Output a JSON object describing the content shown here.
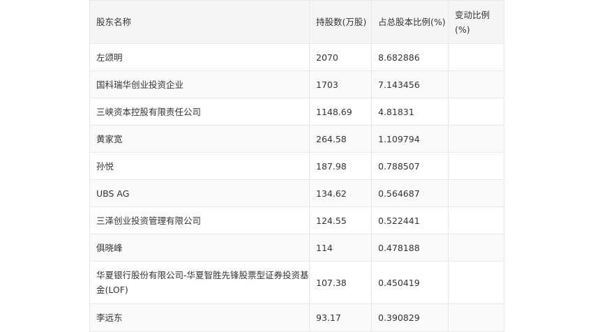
{
  "table": {
    "headers": [
      "股东名称",
      "持股数(万股)",
      "占总股本比例(%)",
      "变动比例(%)"
    ],
    "rows": [
      {
        "name": "左颂明",
        "shares": "2070",
        "ratio": "8.682886",
        "change": ""
      },
      {
        "name": "国科瑞华创业投资企业",
        "shares": "1703",
        "ratio": "7.143456",
        "change": ""
      },
      {
        "name": "三峡资本控股有限责任公司",
        "shares": "1148.69",
        "ratio": "4.81831",
        "change": ""
      },
      {
        "name": "黄家宽",
        "shares": "264.58",
        "ratio": "1.109794",
        "change": ""
      },
      {
        "name": "孙悦",
        "shares": "187.98",
        "ratio": "0.788507",
        "change": ""
      },
      {
        "name": "UBS AG",
        "shares": "134.62",
        "ratio": "0.564687",
        "change": ""
      },
      {
        "name": "三泽创业投资管理有限公司",
        "shares": "124.55",
        "ratio": "0.522441",
        "change": ""
      },
      {
        "name": "俱晓峰",
        "shares": "114",
        "ratio": "0.478188",
        "change": ""
      },
      {
        "name": "华夏银行股份有限公司-华夏智胜先锋股票型证券投资基金(LOF)",
        "shares": "107.38",
        "ratio": "0.450419",
        "change": ""
      },
      {
        "name": "李远东",
        "shares": "93.17",
        "ratio": "0.390829",
        "change": ""
      }
    ]
  }
}
